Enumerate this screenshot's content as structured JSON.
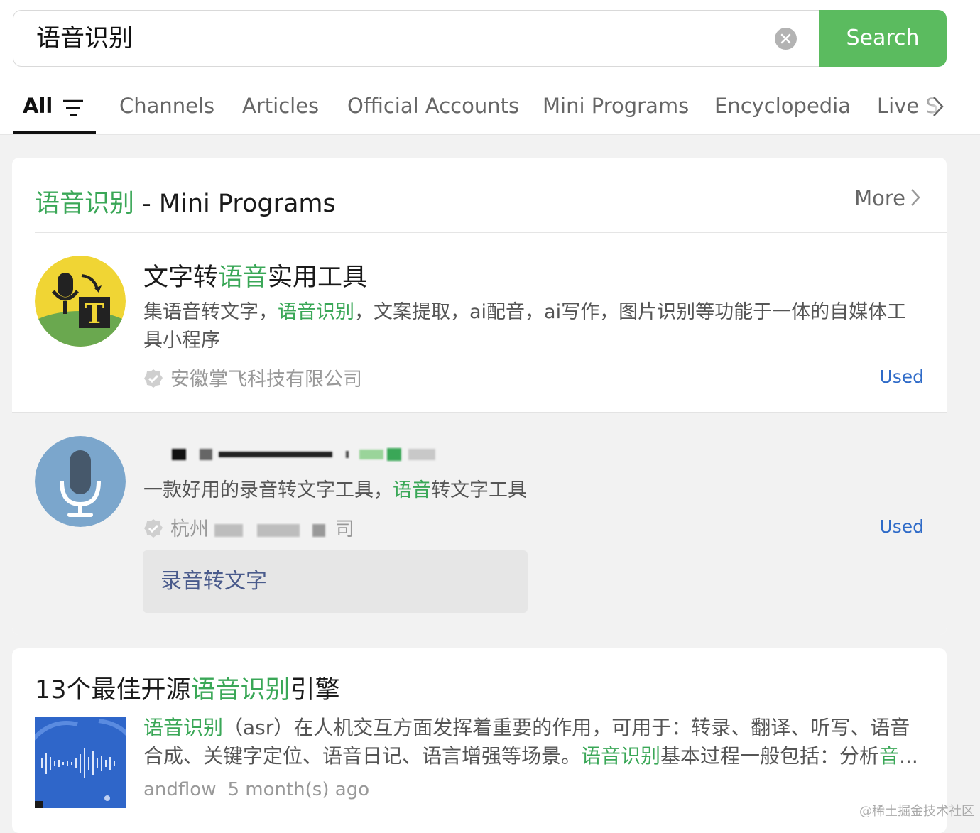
{
  "search": {
    "query": "语音识别",
    "button_label": "Search"
  },
  "tabs": [
    {
      "label": "All",
      "active": true
    },
    {
      "label": "Channels"
    },
    {
      "label": "Articles"
    },
    {
      "label": "Official Accounts"
    },
    {
      "label": "Mini Programs"
    },
    {
      "label": "Encyclopedia"
    },
    {
      "label": "Live S"
    }
  ],
  "mini_section": {
    "title_keyword": "语音识别",
    "title_rest": " - Mini Programs",
    "more_label": "More",
    "items": [
      {
        "title_parts": [
          "文字转",
          "语音",
          "实用工具"
        ],
        "desc_parts": [
          "集语音转文字，",
          "语音识别",
          "，文案提取，ai配音，ai写作，图片识别等功能于一体的自媒体工具小程序"
        ],
        "org": "安徽掌飞科技有限公司",
        "used_label": "Used"
      },
      {
        "desc_parts": [
          "一款好用的录音转文字工具，",
          "语音",
          "转文字工具"
        ],
        "org_visible_start": "杭州",
        "org_visible_end": "司",
        "used_label": "Used",
        "sub_link": "录音转文字"
      }
    ]
  },
  "article": {
    "title_parts": [
      "13个最佳开源",
      "语音识别",
      "引擎"
    ],
    "desc_parts": [
      "语音识别",
      "（asr）在人机交互方面发挥着重要的作用，可用于：转录、翻译、听写、语音合成、关键字定位、语音日记、语言增强等场景。",
      "语音识别",
      "基本过程一般包括：分析",
      "音",
      "..."
    ],
    "author": "andflow",
    "time": "5 month(s) ago"
  },
  "watermark": "@稀土掘金技术社区",
  "colors": {
    "accent_green": "#5bbb5f",
    "highlight_green": "#3aa757",
    "link_blue": "#2f6bc8"
  }
}
